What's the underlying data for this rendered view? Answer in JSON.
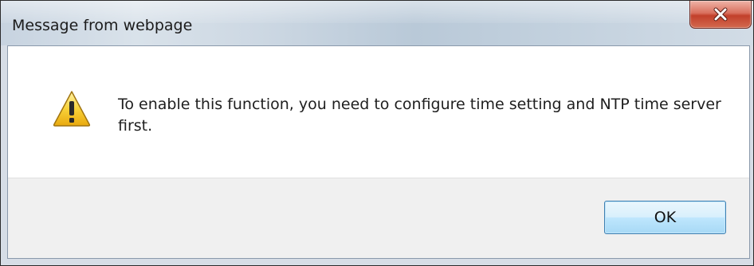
{
  "dialog": {
    "title": "Message from webpage",
    "message": "To enable this function, you need to configure time setting and NTP time server first.",
    "icon": "warning-icon",
    "ok_label": "OK"
  },
  "colors": {
    "close_button": "#c2402b",
    "ok_button_border": "#3c7fb1",
    "warning_yellow": "#f4c431"
  }
}
